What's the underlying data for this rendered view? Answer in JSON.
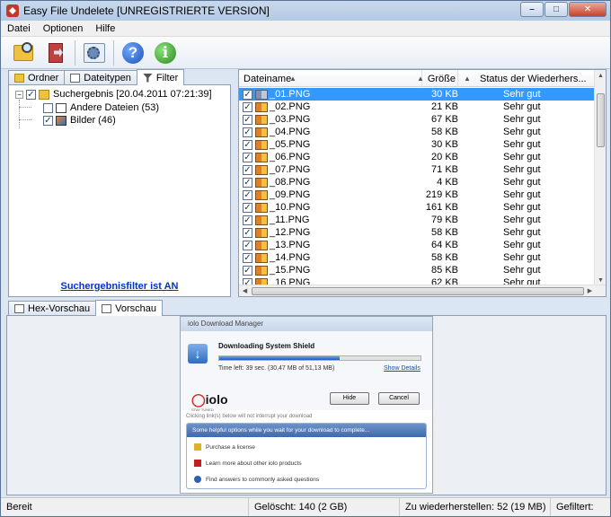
{
  "window": {
    "title": "Easy File Undelete [UNREGISTRIERTE VERSION]"
  },
  "menu": [
    "Datei",
    "Optionen",
    "Hilfe"
  ],
  "toolbar": {
    "icons": [
      "folder-search-icon",
      "document-arrow-icon",
      "settings-icon",
      "help-icon",
      "info-icon"
    ],
    "help_glyph": "?",
    "info_glyph": "i"
  },
  "left_tabs": [
    "Ordner",
    "Dateitypen",
    "Filter"
  ],
  "tree": {
    "root": "Suchergebnis [20.04.2011 07:21:39]",
    "children": [
      "Andere Dateien (53)",
      "Bilder (46)"
    ],
    "filter_link": "Suchergebnisfilter ist AN"
  },
  "file_list": {
    "columns": [
      "Dateiname",
      "Größe",
      "Status der Wiederhers..."
    ],
    "rows": [
      {
        "name": "_01.PNG",
        "size": "30 KB",
        "status": "Sehr gut"
      },
      {
        "name": "_02.PNG",
        "size": "21 KB",
        "status": "Sehr gut"
      },
      {
        "name": "_03.PNG",
        "size": "67 KB",
        "status": "Sehr gut"
      },
      {
        "name": "_04.PNG",
        "size": "58 KB",
        "status": "Sehr gut"
      },
      {
        "name": "_05.PNG",
        "size": "30 KB",
        "status": "Sehr gut"
      },
      {
        "name": "_06.PNG",
        "size": "20 KB",
        "status": "Sehr gut"
      },
      {
        "name": "_07.PNG",
        "size": "71 KB",
        "status": "Sehr gut"
      },
      {
        "name": "_08.PNG",
        "size": "4 KB",
        "status": "Sehr gut"
      },
      {
        "name": "_09.PNG",
        "size": "219 KB",
        "status": "Sehr gut"
      },
      {
        "name": "_10.PNG",
        "size": "161 KB",
        "status": "Sehr gut"
      },
      {
        "name": "_11.PNG",
        "size": "79 KB",
        "status": "Sehr gut"
      },
      {
        "name": "_12.PNG",
        "size": "58 KB",
        "status": "Sehr gut"
      },
      {
        "name": "_13.PNG",
        "size": "64 KB",
        "status": "Sehr gut"
      },
      {
        "name": "_14.PNG",
        "size": "58 KB",
        "status": "Sehr gut"
      },
      {
        "name": "_15.PNG",
        "size": "85 KB",
        "status": "Sehr gut"
      },
      {
        "name": "_16.PNG",
        "size": "62 KB",
        "status": "Sehr gut"
      }
    ]
  },
  "bottom_tabs": [
    "Hex-Vorschau",
    "Vorschau"
  ],
  "preview": {
    "window_title": "iolo Download Manager",
    "heading": "Downloading System Shield",
    "progress": 0.6,
    "time_left": "Time left: 39 sec. (30,47 MB of 51,13 MB)",
    "show_details": "Show Details",
    "logo": "iolo",
    "logo_sub": "STAY TUNED",
    "hide_button": "Hide",
    "cancel_button": "Cancel",
    "note": "Clicking link(s) below will not interrupt your download",
    "panel_heading": "Some helpful options while you wait for your download to complete...",
    "options": [
      "Purchase a license",
      "Learn more about other iolo products",
      "Find answers to commonly asked questions"
    ]
  },
  "status": {
    "ready": "Bereit",
    "deleted": "Gelöscht: 140 (2 GB)",
    "recoverable": "Zu wiederherstellen: 52 (19 MB)",
    "filtered": "Gefiltert:"
  }
}
